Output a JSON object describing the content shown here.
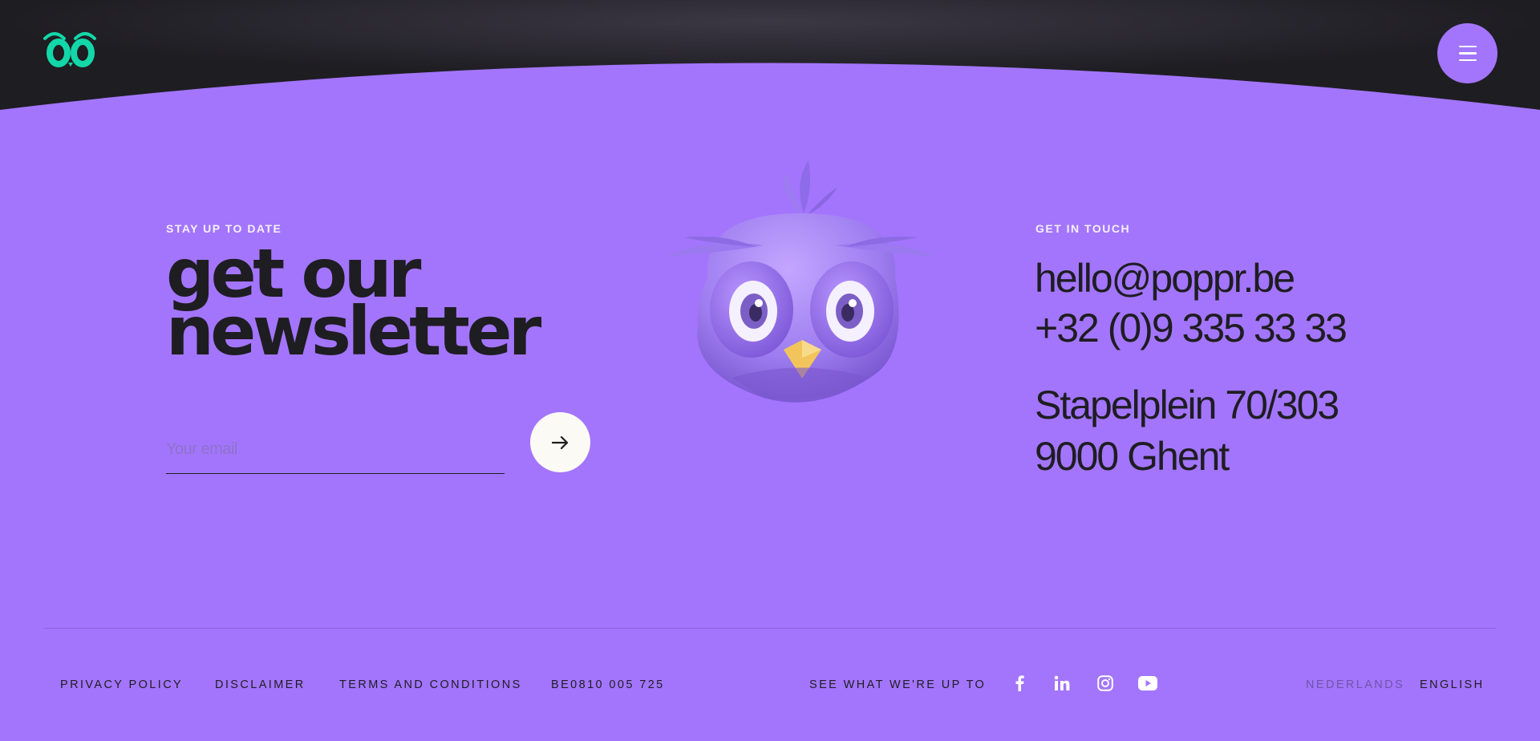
{
  "header": {
    "logo_icon": "poppr-owl-eyes-logo",
    "logo_color": "#13d7a8",
    "menu_icon": "hamburger-icon",
    "dark_color": "#1e1d22"
  },
  "newsletter": {
    "kicker": "STAY UP TO DATE",
    "headline_line1": "get our",
    "headline_line2": "newsletter",
    "email_placeholder": "Your email",
    "submit_icon": "arrow-right-icon"
  },
  "mascot": {
    "icon": "purple-owl-mascot"
  },
  "contact": {
    "kicker": "GET IN TOUCH",
    "email": "hello@poppr.be",
    "phone": "+32 (0)9 335 33 33",
    "address_line1": "Stapelplein 70/303",
    "address_line2": "9000 Ghent"
  },
  "footer": {
    "privacy": "PRIVACY POLICY",
    "disclaimer": "DISCLAIMER",
    "terms": "TERMS AND CONDITIONS",
    "vat": "BE0810 005 725",
    "social_label": "SEE WHAT WE'RE UP TO",
    "socials": [
      "facebook-icon",
      "linkedin-icon",
      "instagram-icon",
      "youtube-icon"
    ],
    "lang_nl": "NEDERLANDS",
    "lang_en": "ENGLISH"
  },
  "colors": {
    "background": "#a375fd",
    "accent_dark": "#1e1d22",
    "button_light": "#fbfaf5"
  }
}
